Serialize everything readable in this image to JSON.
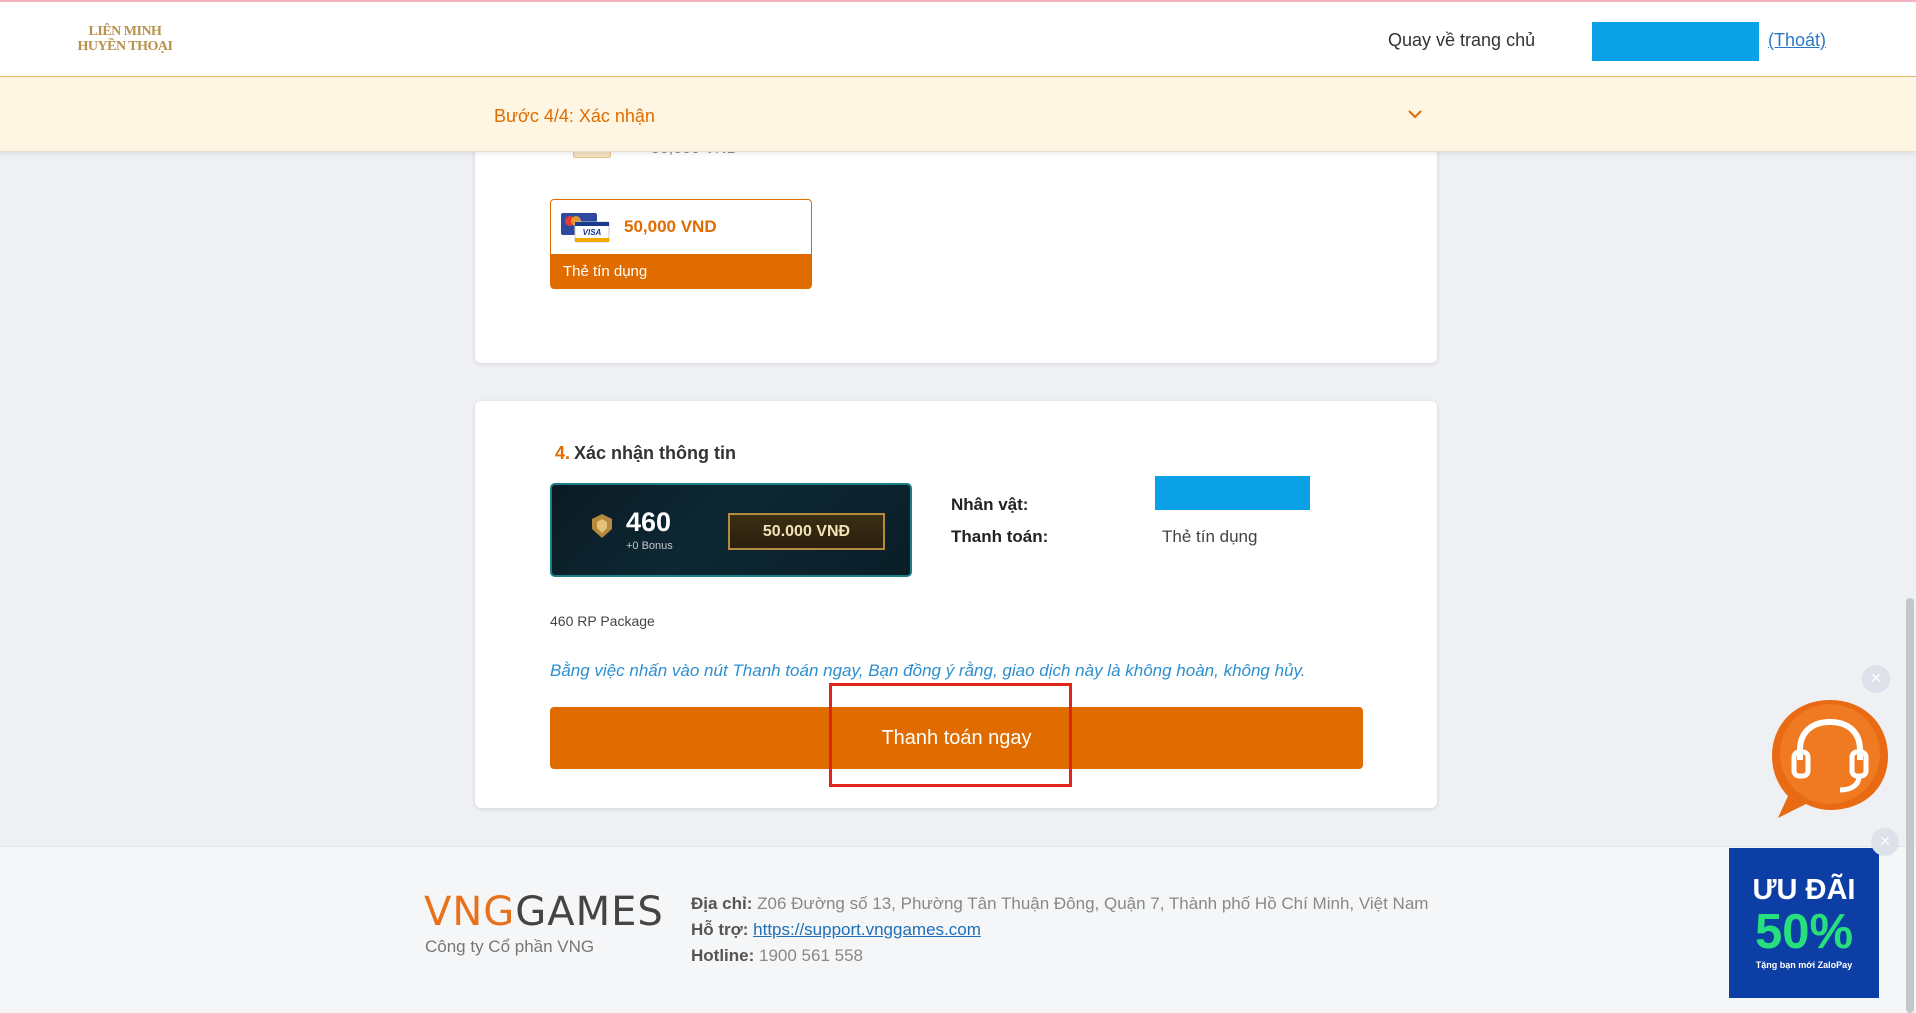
{
  "header": {
    "logo_line1": "LIÊN MINH",
    "logo_line2": "HUYỀN THOẠI",
    "home_link": "Quay về trang chủ",
    "logout_link": "(Thoát)"
  },
  "stepbar": {
    "text": "Bước 4/4: Xác nhận",
    "chevron_icon": "chevron-down-icon"
  },
  "payment_method_card": {
    "partial_amount": "50,000 VND",
    "selected_method": {
      "amount": "50,000 VND",
      "label": "Thẻ tín dụng",
      "icon": "credit-card-visa-mastercard-icon"
    }
  },
  "confirm_section": {
    "number": "4.",
    "title": "Xác nhận thông tin",
    "package": {
      "rp_amount": "460",
      "bonus": "+0 Bonus",
      "price": "50.000 VNĐ",
      "name": "460 RP Package"
    },
    "info": {
      "character_label": "Nhân vật:",
      "payment_label": "Thanh toán:",
      "payment_value": "Thẻ tín dụng"
    },
    "notice": "Bằng việc nhấn vào nút Thanh toán ngay, Bạn đồng ý rằng, giao dịch này là không hoàn, không hủy.",
    "pay_button": "Thanh toán ngay"
  },
  "footer": {
    "logo_vng": "VNG",
    "logo_games": "GAMES",
    "company": "Công ty Cổ phần VNG",
    "address_label": "Địa chỉ:",
    "address": "Z06 Đường số 13, Phường Tân Thuận Đông, Quận 7, Thành phố Hồ Chí Minh, Việt Nam",
    "support_label": "Hỗ trợ:",
    "support_link": "https://support.vnggames.com",
    "hotline_label": "Hotline:",
    "hotline": "1900 561 558"
  },
  "widgets": {
    "chat_icon": "headset-support-icon",
    "close_symbol": "×",
    "promo_line1": "ƯU ĐÃI",
    "promo_line2": "50%",
    "promo_line3": "Tặng bạn mới ZaloPay"
  },
  "colors": {
    "accent": "#e06c00",
    "user_redaction": "#0aa1e6",
    "highlight": "#e1251b",
    "promo_bg": "#0d3ea6",
    "promo_green": "#27e07d"
  }
}
